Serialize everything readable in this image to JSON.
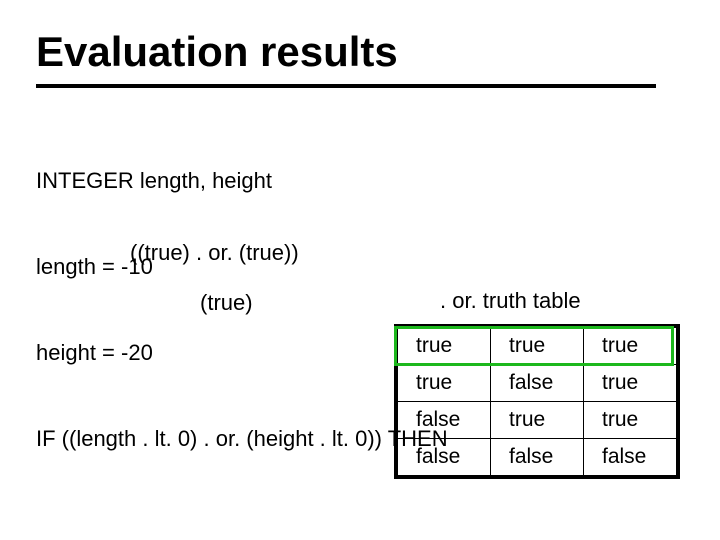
{
  "title": "Evaluation results",
  "code": {
    "line1": "INTEGER length, height",
    "line2": "length = -10",
    "line3": "height = -20",
    "line4": "IF ((length . lt. 0) . or. (height . lt. 0)) THEN"
  },
  "steps": {
    "s1": "((true) . or. (true))",
    "s2": "(true)"
  },
  "table": {
    "caption": ". or. truth table",
    "rows": [
      [
        "true",
        "true",
        "true"
      ],
      [
        "true",
        "false",
        "true"
      ],
      [
        "false",
        "true",
        "true"
      ],
      [
        "false",
        "false",
        "false"
      ]
    ]
  }
}
